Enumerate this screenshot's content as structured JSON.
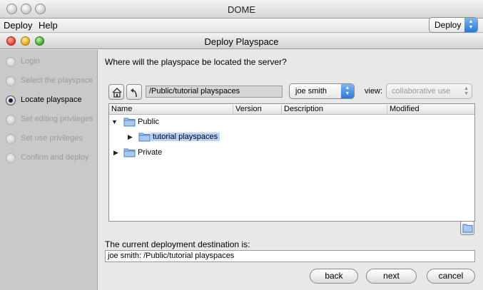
{
  "window": {
    "title": "DOME",
    "menu": [
      "Deploy",
      "Help"
    ],
    "mode_select": "Deploy"
  },
  "dialog": {
    "title": "Deploy Playspace",
    "steps": [
      {
        "label": "Login",
        "state": "done"
      },
      {
        "label": "Select the playspace",
        "state": "done"
      },
      {
        "label": "Locate playspace",
        "state": "current"
      },
      {
        "label": "Set editing privileges",
        "state": "pending"
      },
      {
        "label": "Set use privileges",
        "state": "pending"
      },
      {
        "label": "Confirm and deploy",
        "state": "pending"
      }
    ],
    "question": "Where will the playspace be located the server?",
    "toolbar": {
      "home_icon": "home-icon",
      "up_icon": "up-folder-icon",
      "path": "/Public/tutorial playspaces",
      "user": "joe smith",
      "view_label": "view:",
      "view_value": "collaborative use"
    },
    "tree": {
      "columns": [
        "Name",
        "Version",
        "Description",
        "Modified"
      ],
      "rows": [
        {
          "name": "Public",
          "expanded": true,
          "depth": 0
        },
        {
          "name": "tutorial playspaces",
          "expanded": false,
          "depth": 1,
          "selected": true
        },
        {
          "name": "Private",
          "expanded": false,
          "depth": 0
        }
      ]
    },
    "destination_label": "The current deployment destination is:",
    "destination": "joe smith: /Public/tutorial playspaces",
    "buttons": {
      "back": "back",
      "next": "next",
      "cancel": "cancel"
    }
  },
  "colors": {
    "selection": "#b7d3f8",
    "accent": "#2f76d8"
  }
}
